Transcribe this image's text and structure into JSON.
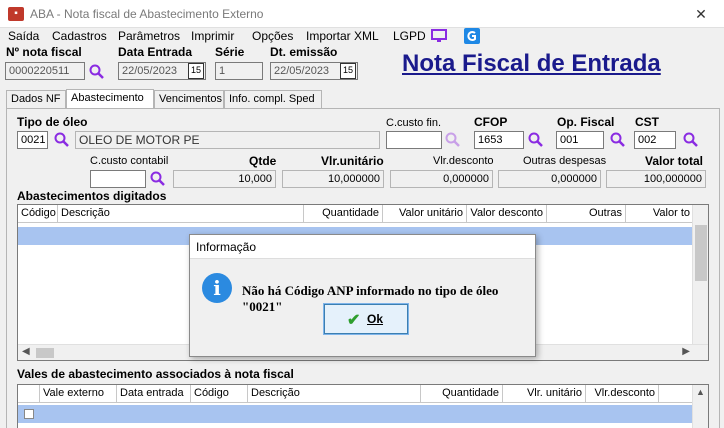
{
  "window": {
    "title": "ABA - Nota fiscal de Abastecimento Externo",
    "close": "✕"
  },
  "menu": {
    "items": [
      "Saída",
      "Cadastros",
      "Parâmetros",
      "Imprimir",
      "Opções",
      "Importar XML",
      "LGPD"
    ]
  },
  "header": {
    "nota_label": "Nº nota fiscal",
    "nota_value": "0000220511",
    "data_entrada_label": "Data Entrada",
    "data_entrada_value": "22/05/2023",
    "serie_label": "Série",
    "serie_value": "1",
    "data_emissao_label": "Dt. emissão",
    "data_emissao_value": "22/05/2023",
    "page_title": "Nota Fiscal de Entrada",
    "cal_icon": "15"
  },
  "tabs": [
    "Dados NF",
    "Abastecimento",
    "Vencimentos",
    "Info. compl. Sped"
  ],
  "form": {
    "tipo_oleo_label": "Tipo de óleo",
    "tipo_oleo_code": "0021",
    "tipo_oleo_desc": "OLEO DE MOTOR PE",
    "ccusto_fin_label": "C.custo fin.",
    "ccusto_fin_value": "",
    "cfop_label": "CFOP",
    "cfop_value": "1653",
    "op_fiscal_label": "Op. Fiscal",
    "op_fiscal_value": "001",
    "cst_label": "CST",
    "cst_value": "002",
    "ccusto_contabil_label": "C.custo contabil",
    "ccusto_contabil_value": "",
    "qtde_label": "Qtde",
    "qtde_value": "10,000",
    "vlr_unit_label": "Vlr.unitário",
    "vlr_unit_value": "10,000000",
    "vlr_desc_label": "Vlr.desconto",
    "vlr_desc_value": "0,000000",
    "outras_label": "Outras despesas",
    "outras_value": "0,000000",
    "total_label": "Valor total",
    "total_value": "100,000000"
  },
  "abastecimentos": {
    "title": "Abastecimentos digitados",
    "columns": [
      "Código",
      "Descrição",
      "Quantidade",
      "Valor unitário",
      "Valor desconto",
      "Outras",
      "Valor to"
    ]
  },
  "vales": {
    "title": "Vales de abastecimento associados à nota fiscal",
    "columns": [
      "Vale externo",
      "Data entrada",
      "Código",
      "Descrição",
      "Quantidade",
      "Vlr. unitário",
      "Vlr.desconto"
    ]
  },
  "dialog": {
    "title": "Informação",
    "message": "Não há Código ANP informado no tipo de óleo \"0021\"",
    "ok_label": "Ok",
    "icon": "i"
  }
}
